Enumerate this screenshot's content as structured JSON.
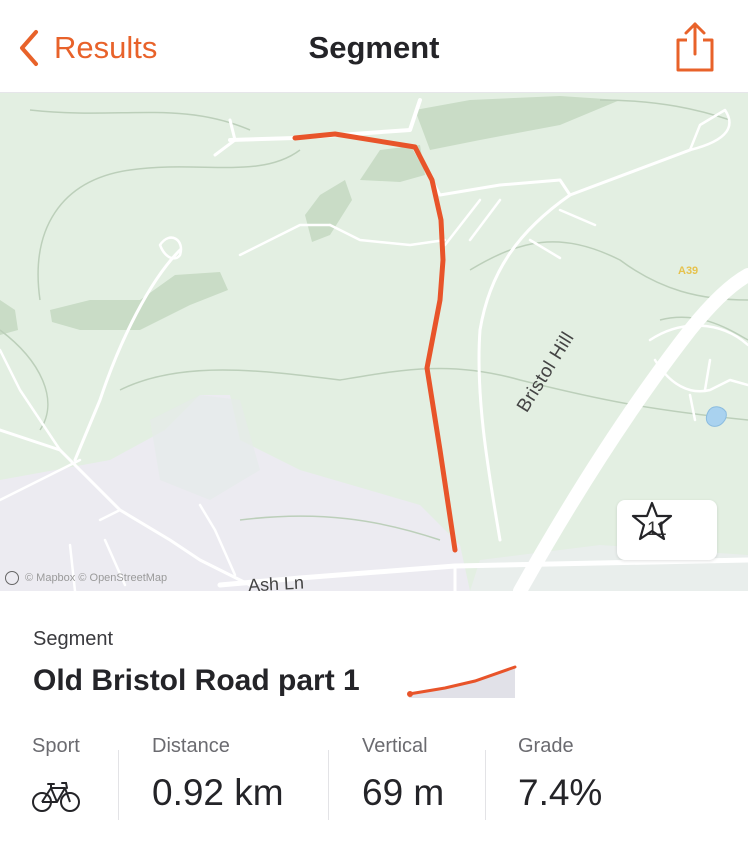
{
  "nav": {
    "back_label": "Results",
    "title": "Segment",
    "back_icon": "chevron-left-icon",
    "share_icon": "share-icon"
  },
  "map": {
    "labels": {
      "road_1": "Bristol Hill",
      "road_2": "Ash Ln",
      "route_badge": "A39"
    },
    "attribution": "© Mapbox © OpenStreetMap",
    "star_count": "11",
    "colors": {
      "route": "#e8542a",
      "land": "#e3efe2",
      "forest": "#c9dcc6",
      "urban": "#ecebf1",
      "road": "#ffffff",
      "water": "#a9d2ef"
    }
  },
  "segment": {
    "caption": "Segment",
    "name": "Old Bristol Road part 1"
  },
  "stats": {
    "sport": {
      "label": "Sport",
      "icon": "bicycle-icon"
    },
    "distance": {
      "label": "Distance",
      "value": "0.92 km"
    },
    "vertical": {
      "label": "Vertical",
      "value": "69 m"
    },
    "grade": {
      "label": "Grade",
      "value": "7.4%"
    }
  },
  "accent": "#e8622a"
}
